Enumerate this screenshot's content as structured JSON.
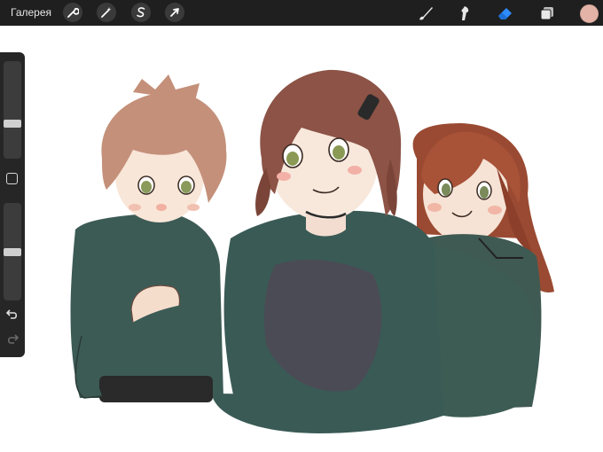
{
  "toolbar": {
    "gallery_label": "Галерея",
    "left_tools": [
      {
        "name": "actions",
        "icon": "wrench-icon"
      },
      {
        "name": "adjustments",
        "icon": "magic-wand-icon"
      },
      {
        "name": "selection",
        "icon": "selection-s-icon"
      },
      {
        "name": "transform",
        "icon": "arrow-cursor-icon"
      }
    ],
    "right_tools": [
      {
        "name": "brush",
        "icon": "brush-icon"
      },
      {
        "name": "smudge",
        "icon": "smudge-icon"
      },
      {
        "name": "eraser",
        "icon": "eraser-icon",
        "active": true
      },
      {
        "name": "layers",
        "icon": "layers-icon"
      }
    ],
    "current_color": "#e3b3a8",
    "active_tool_color": "#2f8cff"
  },
  "sidebar": {
    "brush_size_level": 0.35,
    "opacity_level": 0.5,
    "modify_icon": "square-icon",
    "undo_icon": "undo-icon",
    "redo_icon": "redo-icon"
  }
}
